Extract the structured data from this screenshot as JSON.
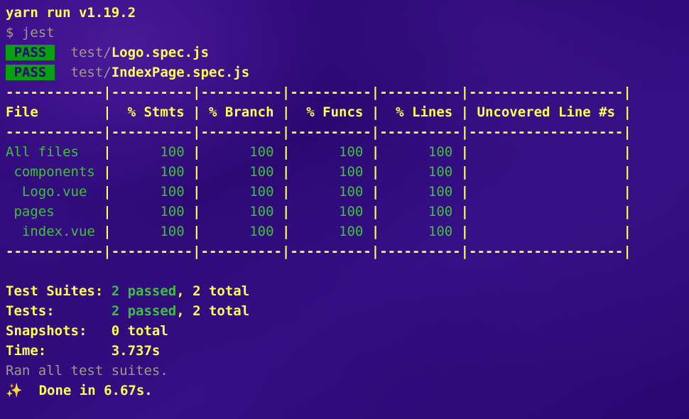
{
  "terminal": {
    "run_header": "yarn run v1.19.2",
    "command_line": "$ jest",
    "pass_label": " PASS ",
    "gap": "  ",
    "suites": [
      {
        "dir": "test/",
        "file": "Logo.spec.js"
      },
      {
        "dir": "test/",
        "file": "IndexPage.spec.js"
      }
    ]
  },
  "coverage_table": {
    "rule_top": "------------|----------|----------|----------|----------|-------------------|",
    "rule_mid": "------------|----------|----------|----------|----------|-------------------|",
    "rule_bottom": "------------|----------|----------|----------|----------|-------------------|",
    "headers": {
      "file": "File        ",
      "stmts": "  % Stmts ",
      "branch": " % Branch ",
      "funcs": "  % Funcs ",
      "lines": "  % Lines ",
      "uncovered": " Uncovered Line #s "
    },
    "rows": [
      {
        "file": "All files   ",
        "stmts": "      100 ",
        "branch": "      100 ",
        "funcs": "      100 ",
        "lines": "      100 ",
        "uncovered": "                   "
      },
      {
        "file": " components ",
        "stmts": "      100 ",
        "branch": "      100 ",
        "funcs": "      100 ",
        "lines": "      100 ",
        "uncovered": "                   "
      },
      {
        "file": "  Logo.vue  ",
        "stmts": "      100 ",
        "branch": "      100 ",
        "funcs": "      100 ",
        "lines": "      100 ",
        "uncovered": "                   "
      },
      {
        "file": " pages      ",
        "stmts": "      100 ",
        "branch": "      100 ",
        "funcs": "      100 ",
        "lines": "      100 ",
        "uncovered": "                   "
      },
      {
        "file": "  index.vue ",
        "stmts": "      100 ",
        "branch": "      100 ",
        "funcs": "      100 ",
        "lines": "      100 ",
        "uncovered": "                   "
      }
    ],
    "pipe": "|"
  },
  "summary": {
    "test_suites": {
      "label": "Test Suites: ",
      "passed": "2 passed",
      "rest": ", 2 total"
    },
    "tests": {
      "label": "Tests:       ",
      "passed": "2 passed",
      "rest": ", 2 total"
    },
    "snapshots": {
      "label": "Snapshots:   ",
      "value": "0 total"
    },
    "time": {
      "label": "Time:        ",
      "value": "3.737s"
    },
    "ran_all": "Ran all test suites.",
    "done": {
      "sparkle": "✨",
      "gap": "  ",
      "text": "Done in 6.67s."
    }
  },
  "colors": {
    "background": "#2f0a79",
    "yellow": "#ffff55",
    "green": "#3dc13d",
    "dim": "#9e9a8c",
    "pass_badge_bg": "#0a9e12",
    "pass_badge_fg": "#2d0878",
    "sparkle": "#f0a830"
  }
}
